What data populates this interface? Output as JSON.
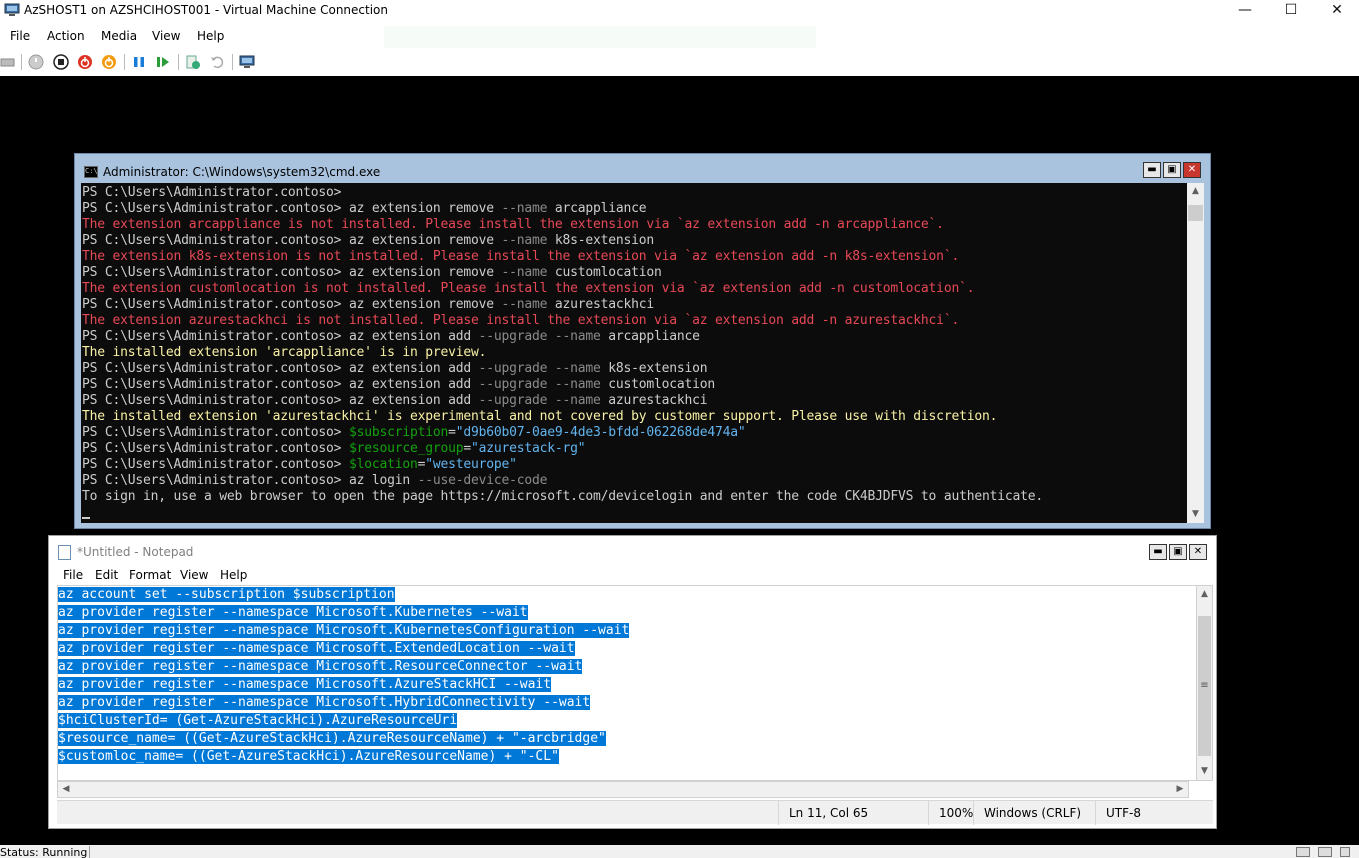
{
  "window": {
    "title": "AzSHOST1 on AZSHCIHOST001 - Virtual Machine Connection",
    "controls": {
      "minimize": "—",
      "maximize": "☐",
      "close": "✕"
    }
  },
  "menu": [
    "File",
    "Action",
    "Media",
    "View",
    "Help"
  ],
  "toolbar": [
    "ctrl-alt-del-icon",
    "start-icon",
    "turn-off-icon",
    "shut-down-icon",
    "save-icon",
    "pause-icon",
    "reset-icon",
    "checkpoint-icon",
    "revert-icon",
    "enhanced-session-icon"
  ],
  "cmd": {
    "title": "Administrator: C:\\Windows\\system32\\cmd.exe",
    "icon_text": "C:\\",
    "prompt": "PS C:\\Users\\Administrator.contoso> ",
    "lines": [
      {
        "t": "cmd",
        "parts": []
      },
      {
        "t": "cmd",
        "parts": [
          [
            "w",
            "az extension remove "
          ],
          [
            "g",
            "--name"
          ],
          [
            "w",
            " arcappliance"
          ]
        ]
      },
      {
        "t": "err",
        "text": "The extension arcappliance is not installed. Please install the extension via `az extension add -n arcappliance`."
      },
      {
        "t": "cmd",
        "parts": [
          [
            "w",
            "az extension remove "
          ],
          [
            "g",
            "--name"
          ],
          [
            "w",
            " k8s-extension"
          ]
        ]
      },
      {
        "t": "err",
        "text": "The extension k8s-extension is not installed. Please install the extension via `az extension add -n k8s-extension`."
      },
      {
        "t": "cmd",
        "parts": [
          [
            "w",
            "az extension remove "
          ],
          [
            "g",
            "--name"
          ],
          [
            "w",
            " customlocation"
          ]
        ]
      },
      {
        "t": "err",
        "text": "The extension customlocation is not installed. Please install the extension via `az extension add -n customlocation`."
      },
      {
        "t": "cmd",
        "parts": [
          [
            "w",
            "az extension remove "
          ],
          [
            "g",
            "--name"
          ],
          [
            "w",
            " azurestackhci"
          ]
        ]
      },
      {
        "t": "err",
        "text": "The extension azurestackhci is not installed. Please install the extension via `az extension add -n azurestackhci`."
      },
      {
        "t": "cmd",
        "parts": [
          [
            "w",
            "az extension add "
          ],
          [
            "g",
            "--upgrade --name"
          ],
          [
            "w",
            " arcappliance"
          ]
        ]
      },
      {
        "t": "warn",
        "text": "The installed extension 'arcappliance' is in preview."
      },
      {
        "t": "cmd",
        "parts": [
          [
            "w",
            "az extension add "
          ],
          [
            "g",
            "--upgrade --name"
          ],
          [
            "w",
            " k8s-extension"
          ]
        ]
      },
      {
        "t": "cmd",
        "parts": [
          [
            "w",
            "az extension add "
          ],
          [
            "g",
            "--upgrade --name"
          ],
          [
            "w",
            " customlocation"
          ]
        ]
      },
      {
        "t": "cmd",
        "parts": [
          [
            "w",
            "az extension add "
          ],
          [
            "g",
            "--upgrade --name"
          ],
          [
            "w",
            " azurestackhci"
          ]
        ]
      },
      {
        "t": "warn",
        "text": "The installed extension 'azurestackhci' is experimental and not covered by customer support. Please use with discretion."
      },
      {
        "t": "cmd",
        "parts": [
          [
            "grn",
            "$subscription"
          ],
          [
            "w",
            "="
          ],
          [
            "cy",
            "\"d9b60b07-0ae9-4de3-bfdd-062268de474a\""
          ]
        ]
      },
      {
        "t": "cmd",
        "parts": [
          [
            "grn",
            "$resource_group"
          ],
          [
            "w",
            "="
          ],
          [
            "cy",
            "\"azurestack-rg\""
          ]
        ]
      },
      {
        "t": "cmd",
        "parts": [
          [
            "grn",
            "$location"
          ],
          [
            "w",
            "="
          ],
          [
            "cy",
            "\"westeurope\""
          ]
        ]
      },
      {
        "t": "cmd",
        "parts": [
          [
            "w",
            "az login "
          ],
          [
            "g",
            "--use-device-code"
          ]
        ]
      },
      {
        "t": "out",
        "text": "To sign in, use a web browser to open the page https://microsoft.com/devicelogin and enter the code CK4BJDFVS to authenticate."
      }
    ]
  },
  "notepad": {
    "title": "*Untitled - Notepad",
    "menu": [
      "File",
      "Edit",
      "Format",
      "View",
      "Help"
    ],
    "lines": [
      "az account set --subscription $subscription",
      "az provider register --namespace Microsoft.Kubernetes --wait",
      "az provider register --namespace Microsoft.KubernetesConfiguration --wait",
      "az provider register --namespace Microsoft.ExtendedLocation --wait",
      "az provider register --namespace Microsoft.ResourceConnector --wait",
      "az provider register --namespace Microsoft.AzureStackHCI --wait",
      "az provider register --namespace Microsoft.HybridConnectivity --wait",
      "$hciClusterId= (Get-AzureStackHci).AzureResourceUri",
      "$resource_name= ((Get-AzureStackHci).AzureResourceName) + \"-arcbridge\"",
      "$customloc_name= ((Get-AzureStackHci).AzureResourceName) + \"-CL\""
    ],
    "status": {
      "position": "Ln 11, Col 65",
      "zoom": "100%",
      "line_endings": "Windows (CRLF)",
      "encoding": "UTF-8"
    }
  },
  "vm_status": "Status: Running",
  "colors": {
    "console_bg": "#0c0c0c",
    "error": "#e74856",
    "warning": "#f9f1a5",
    "selection": "#0078d7"
  }
}
